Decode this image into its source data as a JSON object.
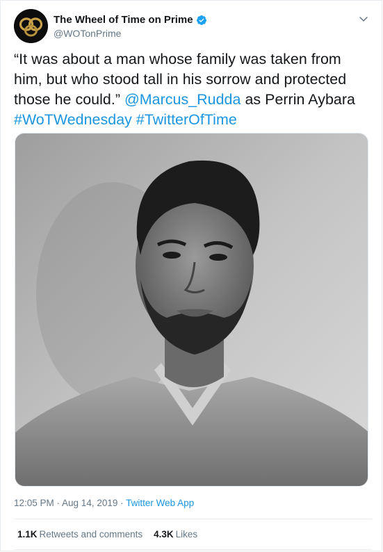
{
  "tweet": {
    "author": {
      "display_name": "The Wheel of Time on Prime",
      "handle": "@WOTonPrime",
      "verified": true,
      "avatar_icon": "wheel-of-time-logo-icon"
    },
    "text": {
      "quote": "“It was about a man whose family was taken from him, but who stood tall in his sorrow and protected those he could.”",
      "mention": "@Marcus_Rudda",
      "after_mention": "as Perrin Aybara",
      "hashtag_1": "#WoTWednesday",
      "hashtag_2": "#TwitterOfTime"
    },
    "media": {
      "kind": "black-and-white portrait photo"
    },
    "timestamp": "12:05 PM · Aug 14, 2019",
    "separator": " · ",
    "source": "Twitter Web App",
    "stats": {
      "retweets_count": "1.1K",
      "retweets_label": "Retweets and comments",
      "likes_count": "4.3K",
      "likes_label": "Likes"
    }
  },
  "colors": {
    "link": "#1b95e0",
    "verified": "#1da1f2",
    "secondary_text": "#657786",
    "primary_text": "#14171a",
    "border": "#e6ecf0"
  }
}
